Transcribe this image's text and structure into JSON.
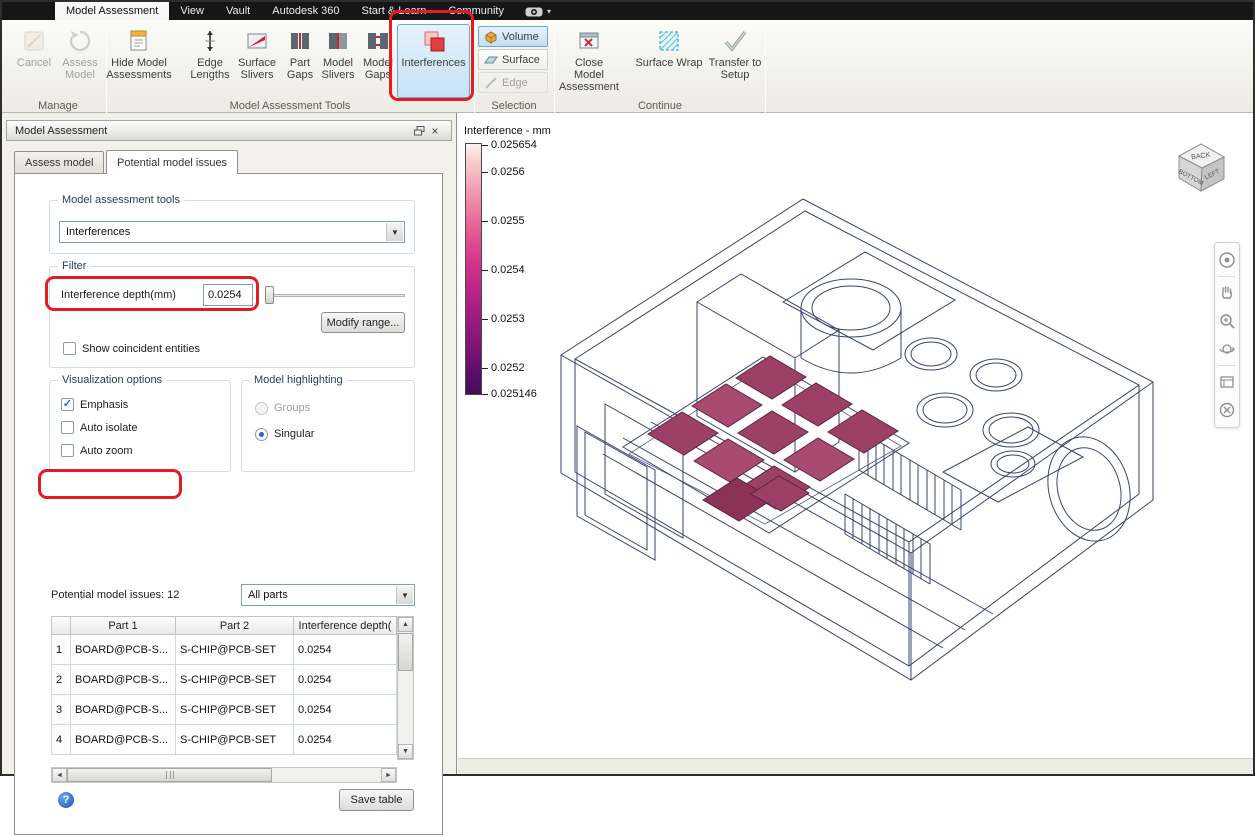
{
  "menubar": {
    "items": [
      "Model Assessment",
      "View",
      "Vault",
      "Autodesk 360",
      "Start & Learn",
      "Community"
    ]
  },
  "ribbon": {
    "manage": {
      "label": "Manage",
      "cancel": "Cancel",
      "assess": "Assess Model"
    },
    "tools": {
      "label": "Model Assessment Tools",
      "hide": "Hide Model Assessments",
      "edge_lengths": "Edge Lengths",
      "surface_slivers": "Surface Slivers",
      "part_gaps": "Part Gaps",
      "model_slivers": "Model Slivers",
      "model_gaps": "Model Gaps",
      "interferences": "Interferences",
      "interferences_selected": true
    },
    "selection": {
      "label": "Selection",
      "volume": "Volume",
      "surface": "Surface",
      "edge": "Edge",
      "volume_selected": true,
      "edge_disabled": true
    },
    "continue": {
      "label": "Continue",
      "close": "Close Model Assessment",
      "surface_wrap": "Surface Wrap",
      "transfer": "Transfer to Setup"
    }
  },
  "panel": {
    "title": "Model Assessment",
    "tabs": [
      "Assess model",
      "Potential model issues"
    ],
    "active_tab": "Potential model issues",
    "tools_group": {
      "legend": "Model assessment tools",
      "dropdown_value": "Interferences"
    },
    "filter_group": {
      "legend": "Filter",
      "depth_label": "Interference depth(mm)",
      "depth_value": "0.0254",
      "modify_button": "Modify range...",
      "coincident_label": "Show coincident entities",
      "coincident_checked": false,
      "slider_position": 0.02
    },
    "visualization": {
      "legend": "Visualization options",
      "options": [
        {
          "label": "Emphasis",
          "checked": true
        },
        {
          "label": "Auto isolate",
          "checked": false
        },
        {
          "label": "Auto zoom",
          "checked": false
        }
      ]
    },
    "highlighting": {
      "legend": "Model highlighting",
      "options": [
        {
          "label": "Groups",
          "selected": false,
          "disabled": true
        },
        {
          "label": "Singular",
          "selected": true
        }
      ]
    },
    "issues_label": "Potential model issues: 12",
    "parts_dropdown": "All parts",
    "table": {
      "headers": [
        "",
        "Part 1",
        "Part 2",
        "Interference depth("
      ],
      "rows": [
        {
          "num": "1",
          "part1": "BOARD@PCB-S...",
          "part2": "S-CHIP@PCB-SET",
          "depth": "0.0254"
        },
        {
          "num": "2",
          "part1": "BOARD@PCB-S...",
          "part2": "S-CHIP@PCB-SET",
          "depth": "0.0254"
        },
        {
          "num": "3",
          "part1": "BOARD@PCB-S...",
          "part2": "S-CHIP@PCB-SET",
          "depth": "0.0254"
        },
        {
          "num": "4",
          "part1": "BOARD@PCB-S...",
          "part2": "S-CHIP@PCB-SET",
          "depth": "0.0254"
        }
      ]
    },
    "save_button": "Save table",
    "help_glyph": "?"
  },
  "legend": {
    "title": "Interference - mm",
    "ticks": [
      "0.025654",
      "0.0256",
      "0.0255",
      "0.0254",
      "0.0253",
      "0.0252",
      "0.025146"
    ],
    "color_top": "#fdf4f2",
    "color_mid": "#d23389",
    "color_bottom": "#470b5a"
  },
  "viewcube": {
    "top_face": "BACK",
    "right_face": "LEFT",
    "left_face": "BOTTOM"
  },
  "nav_icons": [
    "navigation-wheel",
    "pan-hand",
    "zoom",
    "orbit",
    "view-list",
    "disable"
  ],
  "annotations": {
    "color": "#e41b23",
    "count": 3
  }
}
